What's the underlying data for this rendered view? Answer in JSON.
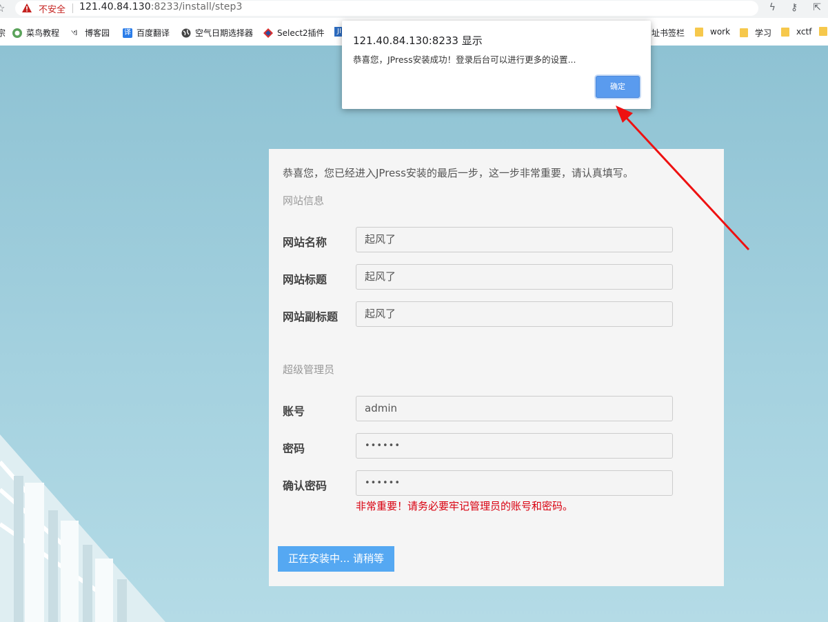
{
  "browser": {
    "security_label": "不安全",
    "url_host": "121.40.84.130",
    "url_rest": ":8233/install/step3",
    "bookmarks": [
      "菜鸟教程",
      "博客园",
      "百度翻译",
      "空气日期选择器",
      "Select2插件",
      "址书签栏",
      "work",
      "学习",
      "xctf"
    ],
    "icons": [
      "star-icon",
      "warning-icon",
      "lightning-icon",
      "key-icon",
      "share-icon"
    ]
  },
  "dialog": {
    "title": "121.40.84.130:8233 显示",
    "message": "恭喜您，JPress安装成功！登录后台可以进行更多的设置...",
    "ok_label": "确定"
  },
  "form": {
    "intro": "恭喜您，您已经进入JPress安装的最后一步，这一步非常重要，请认真填写。",
    "site_section": "网站信息",
    "site_name_label": "网站名称",
    "site_name_value": "起风了",
    "site_title_label": "网站标题",
    "site_title_value": "起风了",
    "site_subtitle_label": "网站副标题",
    "site_subtitle_value": "起风了",
    "admin_section": "超级管理员",
    "account_label": "账号",
    "account_value": "admin",
    "password_label": "密码",
    "password_value": "••••••",
    "confirm_label": "确认密码",
    "confirm_value": "••••••",
    "warning": "非常重要！请务必要牢记管理员的账号和密码。",
    "install_button": "正在安装中... 请稍等"
  },
  "colors": {
    "accent": "#55a8f2",
    "warning": "#d9000f",
    "dialog_button": "#5a9bee",
    "annotation_arrow": "#ee1111"
  }
}
